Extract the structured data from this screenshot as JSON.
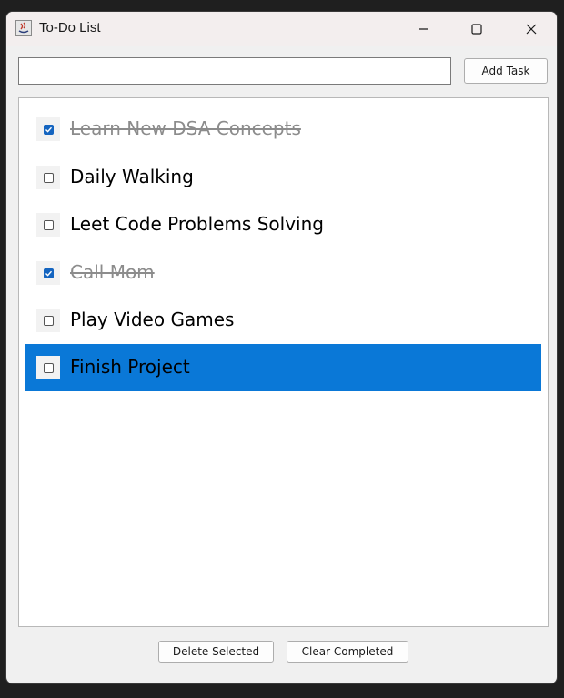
{
  "window": {
    "title": "To-Do List",
    "app_icon": "java-icon",
    "controls": [
      "minimize-icon",
      "maximize-icon",
      "close-icon"
    ]
  },
  "input": {
    "value": "",
    "placeholder": ""
  },
  "buttons": {
    "add_task": "Add Task",
    "delete_selected": "Delete Selected",
    "clear_completed": "Clear Completed"
  },
  "tasks": [
    {
      "label": "Learn New DSA Concepts",
      "completed": true,
      "selected": false
    },
    {
      "label": "Daily Walking",
      "completed": false,
      "selected": false
    },
    {
      "label": "Leet Code Problems Solving",
      "completed": false,
      "selected": false
    },
    {
      "label": "Call Mom",
      "completed": true,
      "selected": false
    },
    {
      "label": "Play Video Games",
      "completed": false,
      "selected": false
    },
    {
      "label": "Finish Project",
      "completed": false,
      "selected": true
    }
  ],
  "colors": {
    "selection": "#0a78d7",
    "checkbox_checked": "#1565c0",
    "completed_text": "#8c8c8c"
  }
}
